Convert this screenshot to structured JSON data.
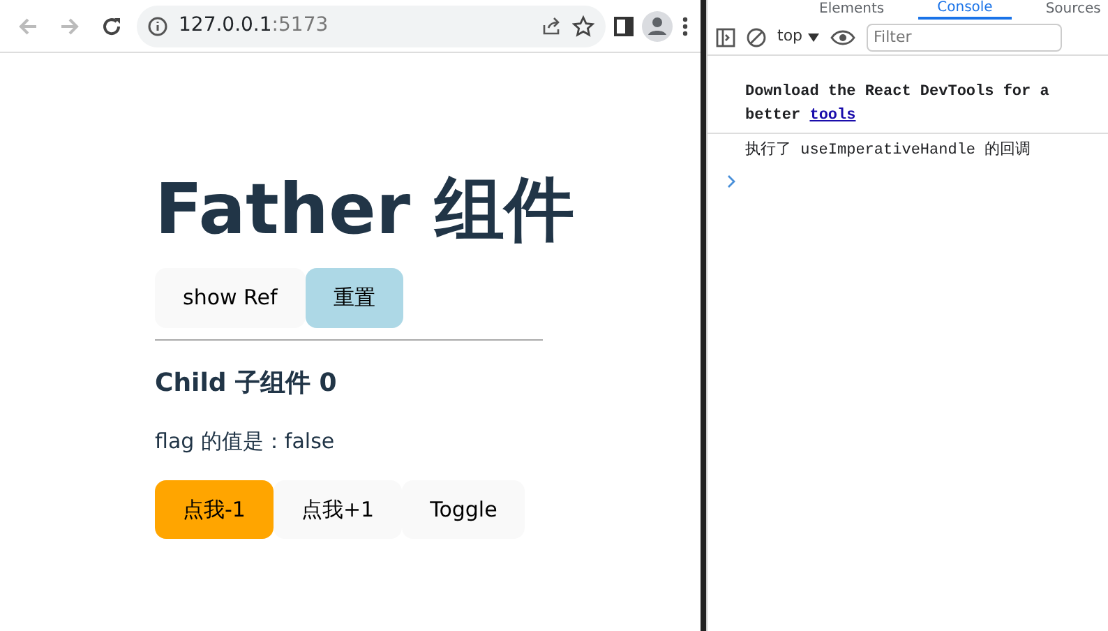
{
  "browser": {
    "address_host": "127.0.0.1",
    "address_port": ":5173"
  },
  "page": {
    "title": "Father 组件",
    "father_buttons": [
      {
        "label": "show Ref",
        "color": "#f9f9f9"
      },
      {
        "label": "重置",
        "color": "#add8e6"
      }
    ],
    "child_title": "Child 子组件 0",
    "flag_text": "flag 的值是：false",
    "child_buttons": [
      {
        "label": "点我-1",
        "color": "#ffa500"
      },
      {
        "label": "点我+1",
        "color": "#f9f9f9"
      },
      {
        "label": "Toggle",
        "color": "#f9f9f9"
      }
    ]
  },
  "devtools": {
    "tabs": [
      {
        "label": "Elements",
        "selected": false
      },
      {
        "label": "Console",
        "selected": true
      },
      {
        "label": "Sources",
        "selected": false
      }
    ],
    "context": "top",
    "filter_placeholder": "Filter",
    "messages": [
      {
        "kind": "link",
        "text": "Download the React DevTools for a better",
        "link": "tools"
      },
      {
        "kind": "log",
        "text": "执行了 useImperativeHandle 的回调"
      }
    ]
  }
}
